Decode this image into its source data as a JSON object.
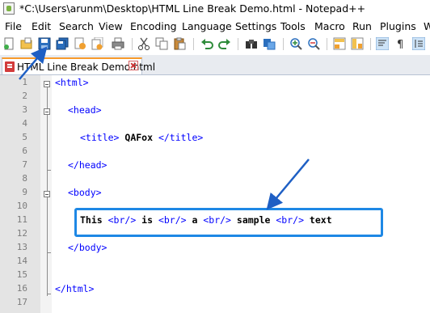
{
  "window": {
    "title": "*C:\\Users\\arunm\\Desktop\\HTML Line Break Demo.html - Notepad++"
  },
  "menu": {
    "items": [
      "File",
      "Edit",
      "Search",
      "View",
      "Encoding",
      "Language",
      "Settings",
      "Tools",
      "Macro",
      "Run",
      "Plugins",
      "W"
    ]
  },
  "toolbar": {
    "buttons": [
      "new-file-icon",
      "open-file-icon",
      "save-icon",
      "save-all-icon",
      "close-icon",
      "close-all-icon",
      "print-icon",
      "cut-icon",
      "copy-icon",
      "paste-icon",
      "undo-icon",
      "redo-icon",
      "find-icon",
      "replace-icon",
      "zoom-in-icon",
      "zoom-out-icon",
      "sync-vertical-icon",
      "sync-horizontal-icon",
      "word-wrap-icon",
      "show-all-chars-icon",
      "indent-guide-icon"
    ]
  },
  "tab": {
    "label": "HTML Line Break Demo.html"
  },
  "editor": {
    "line_numbers": [
      "1",
      "2",
      "3",
      "4",
      "5",
      "6",
      "7",
      "8",
      "9",
      "10",
      "11",
      "12",
      "13",
      "14",
      "15",
      "16",
      "17"
    ],
    "lines": {
      "l1": {
        "tag_open": "<html>"
      },
      "l3": {
        "tag_open": "<head>"
      },
      "l5": {
        "tag_open": "<title>",
        "text": " QAFox ",
        "tag_close": "</title>"
      },
      "l7": {
        "tag_close": "</head>"
      },
      "l9": {
        "tag_open": "<body>"
      },
      "l11": {
        "t1": "This ",
        "br1": "<br/>",
        "t2": " is ",
        "br2": "<br/>",
        "t3": " a ",
        "br3": "<br/>",
        "t4": " sample ",
        "br4": "<br/>",
        "t5": " text"
      },
      "l13": {
        "tag_close": "</body>"
      },
      "l16": {
        "tag_close": "</html>"
      }
    }
  },
  "colors": {
    "tag": "#0000ff",
    "annotation": "#1e88e5",
    "tab_accent": "#f79a2c"
  }
}
